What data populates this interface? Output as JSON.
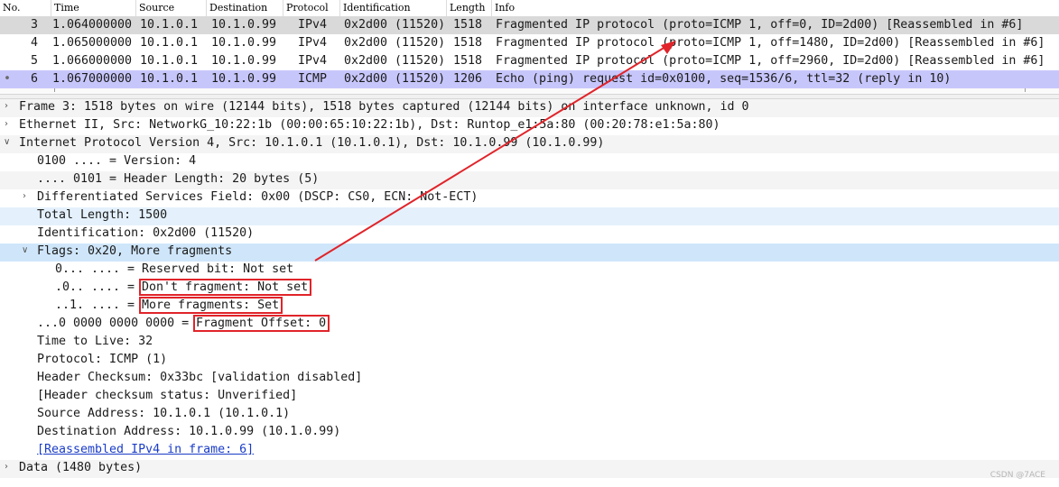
{
  "packet_list": {
    "columns": [
      "No.",
      "Time",
      "Source",
      "Destination",
      "Protocol",
      "Identification",
      "Length",
      "Info"
    ],
    "rows": [
      {
        "no": "3",
        "time": "1.064000000",
        "source": "10.1.0.1",
        "destination": "10.1.0.99",
        "protocol": "IPv4",
        "identification": "0x2d00 (11520)",
        "length": "1518",
        "info": "Fragmented IP protocol (proto=ICMP 1, off=0, ID=2d00) [Reassembled in #6]",
        "marker": "",
        "style": "selected-gray"
      },
      {
        "no": "4",
        "time": "1.065000000",
        "source": "10.1.0.1",
        "destination": "10.1.0.99",
        "protocol": "IPv4",
        "identification": "0x2d00 (11520)",
        "length": "1518",
        "info": "Fragmented IP protocol (proto=ICMP 1, off=1480, ID=2d00) [Reassembled in #6]",
        "marker": "",
        "style": "normal"
      },
      {
        "no": "5",
        "time": "1.066000000",
        "source": "10.1.0.1",
        "destination": "10.1.0.99",
        "protocol": "IPv4",
        "identification": "0x2d00 (11520)",
        "length": "1518",
        "info": "Fragmented IP protocol (proto=ICMP 1, off=2960, ID=2d00) [Reassembled in #6]",
        "marker": "",
        "style": "normal"
      },
      {
        "no": "6",
        "time": "1.067000000",
        "source": "10.1.0.1",
        "destination": "10.1.0.99",
        "protocol": "ICMP",
        "identification": "0x2d00 (11520)",
        "length": "1206",
        "info": "Echo (ping) request  id=0x0100, seq=1536/6, ttl=32 (reply in 10)",
        "marker": "•",
        "style": "icmp"
      }
    ]
  },
  "details": {
    "frame": "Frame 3: 1518 bytes on wire (12144 bits), 1518 bytes captured (12144 bits) on interface unknown, id 0",
    "ethernet": "Ethernet II, Src: NetworkG_10:22:1b (00:00:65:10:22:1b), Dst: Runtop_e1:5a:80 (00:20:78:e1:5a:80)",
    "ipv4": "Internet Protocol Version 4, Src: 10.1.0.1 (10.1.0.1), Dst: 10.1.0.99 (10.1.0.99)",
    "version": "0100 .... = Version: 4",
    "header_length": ".... 0101 = Header Length: 20 bytes (5)",
    "dsf": "Differentiated Services Field: 0x00 (DSCP: CS0, ECN: Not-ECT)",
    "total_length": "Total Length: 1500",
    "identification": "Identification: 0x2d00 (11520)",
    "flags": "Flags: 0x20, More fragments",
    "reserved_bit_prefix": "0... .... = ",
    "reserved_bit_value": "Reserved bit: Not set",
    "dont_fragment_prefix": ".0.. .... = ",
    "dont_fragment_value": "Don't fragment: Not set",
    "more_fragments_prefix": "..1. .... = ",
    "more_fragments_value": "More fragments: Set",
    "fragment_offset_prefix": "...0 0000 0000 0000 = ",
    "fragment_offset_value": "Fragment Offset: 0",
    "ttl": "Time to Live: 32",
    "protocol": "Protocol: ICMP (1)",
    "checksum": "Header Checksum: 0x33bc [validation disabled]",
    "checksum_status": "[Header checksum status: Unverified]",
    "source_address": "Source Address: 10.1.0.1 (10.1.0.1)",
    "destination_address": "Destination Address: 10.1.0.99 (10.1.0.99)",
    "reassembled_link": "[Reassembled IPv4 in frame: 6]",
    "data": "Data (1480 bytes)"
  },
  "watermark": "CSDN @7ACE",
  "colors": {
    "selected_gray": "#d9d9d9",
    "icmp_row": "#c7c6fb",
    "highlight_row": "#cde8fb",
    "light_row": "#eef6fd",
    "annotation_red": "#e0242a"
  }
}
